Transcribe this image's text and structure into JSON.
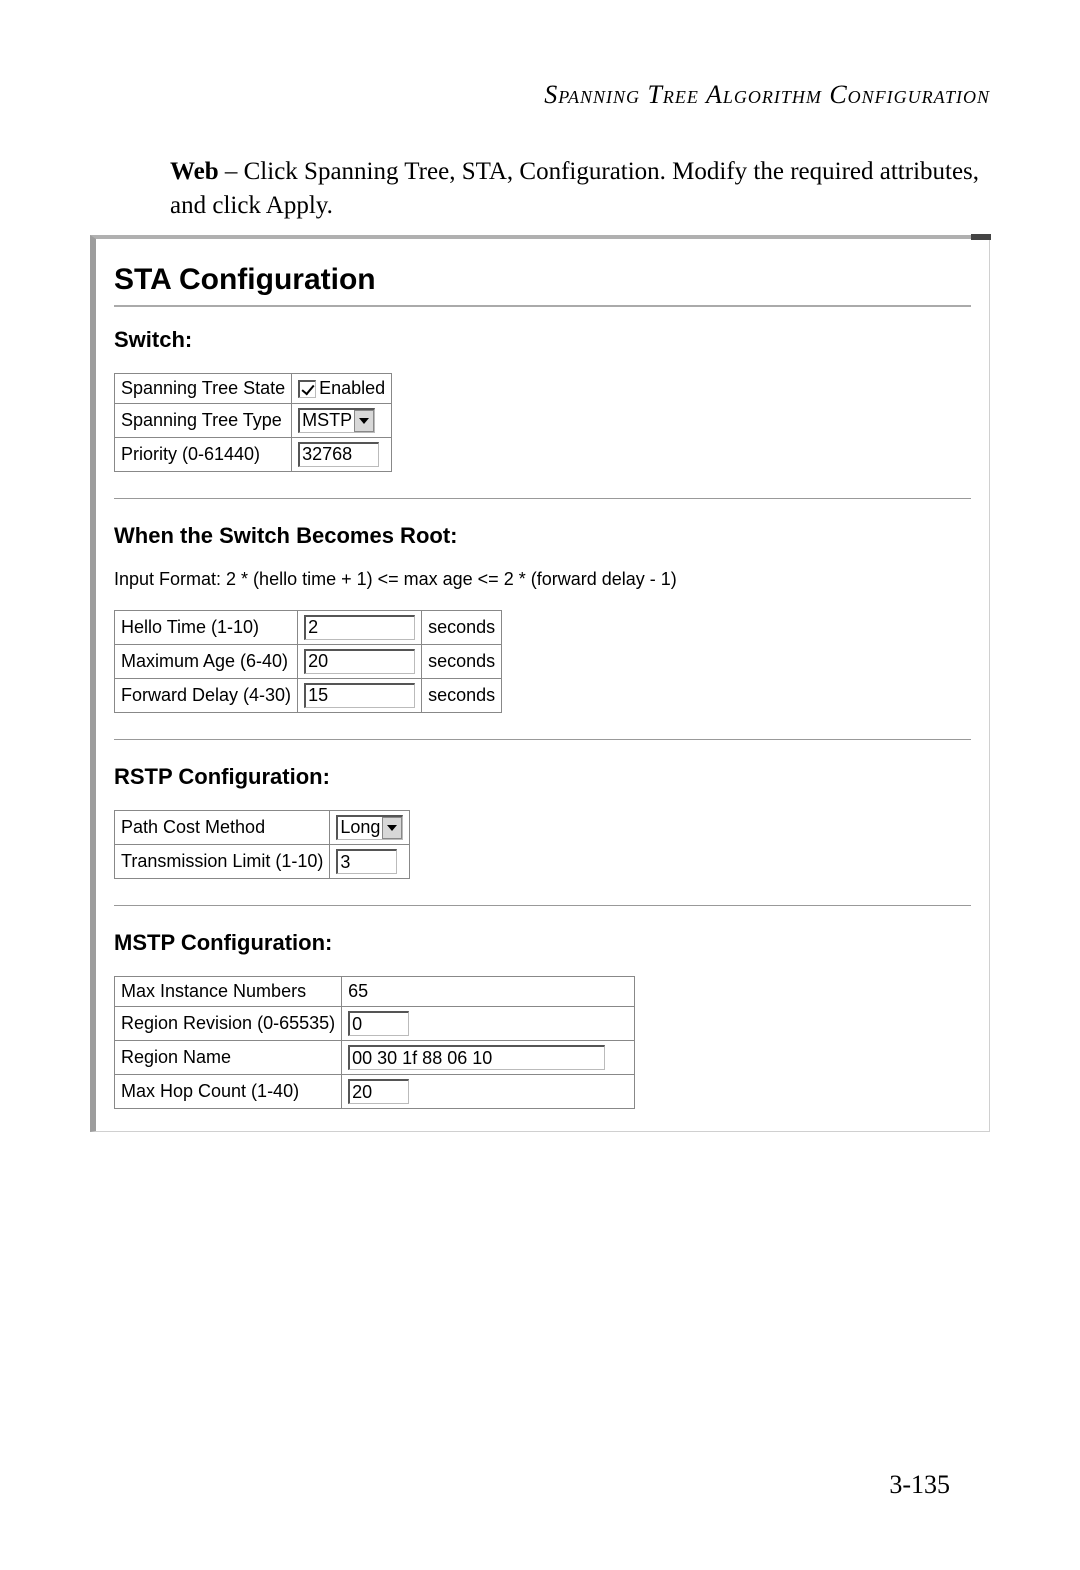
{
  "header": "Spanning Tree Algorithm Configuration",
  "intro": {
    "prefix": "Web",
    "rest": " – Click Spanning Tree, STA, Configuration. Modify the required attributes, and click Apply."
  },
  "page_number": "3-135",
  "ui": {
    "title": "STA Configuration",
    "switch": {
      "heading": "Switch:",
      "rows": {
        "state_label": "Spanning Tree State",
        "state_value": "Enabled",
        "type_label": "Spanning Tree Type",
        "type_value": "MSTP",
        "priority_label": "Priority (0-61440)",
        "priority_value": "32768"
      }
    },
    "root": {
      "heading": "When the Switch Becomes Root:",
      "hint": "Input Format: 2 * (hello time + 1) <= max age <= 2 * (forward delay - 1)",
      "rows": {
        "hello_label": "Hello Time (1-10)",
        "hello_value": "2",
        "maxage_label": "Maximum Age (6-40)",
        "maxage_value": "20",
        "fwd_label": "Forward Delay (4-30)",
        "fwd_value": "15",
        "seconds": "seconds"
      }
    },
    "rstp": {
      "heading": "RSTP Configuration:",
      "rows": {
        "pcm_label": "Path Cost Method",
        "pcm_value": "Long",
        "tx_label": "Transmission Limit (1-10)",
        "tx_value": "3"
      }
    },
    "mstp": {
      "heading": "MSTP Configuration:",
      "rows": {
        "max_inst_label": "Max Instance Numbers",
        "max_inst_value": "65",
        "region_rev_label": "Region Revision (0-65535)",
        "region_rev_value": "0",
        "region_name_label": "Region Name",
        "region_name_value": "00 30 1f 88 06 10",
        "max_hop_label": "Max Hop Count (1-40)",
        "max_hop_value": "20"
      }
    }
  }
}
